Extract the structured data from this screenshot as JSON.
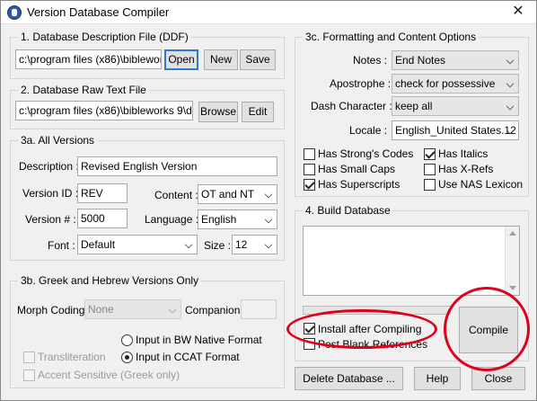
{
  "window": {
    "title": "Version Database Compiler"
  },
  "ddf": {
    "group_label": "1. Database Description File (DDF)",
    "path": "c:\\program files (x86)\\bibleworks 9",
    "open_label": "Open",
    "new_label": "New",
    "save_label": "Save"
  },
  "raw": {
    "group_label": "2. Database Raw Text File",
    "path": "c:\\program files (x86)\\bibleworks 9\\databa",
    "browse_label": "Browse",
    "edit_label": "Edit"
  },
  "all_versions": {
    "group_label": "3a.  All Versions",
    "description_label": "Description :",
    "description_value": "Revised English Version",
    "version_id_label": "Version ID :",
    "version_id_value": "REV",
    "content_label": "Content :",
    "content_value": "OT and NT",
    "version_num_label": "Version # :",
    "version_num_value": "5000",
    "language_label": "Language :",
    "language_value": "English",
    "font_label": "Font :",
    "font_value": "Default",
    "size_label": "Size :",
    "size_value": "12"
  },
  "greek_hebrew": {
    "group_label": "3b.  Greek and Hebrew Versions Only",
    "morph_label": "Morph Coding :",
    "morph_value": "None",
    "companion_label": "Companion :",
    "companion_value": "",
    "radio_bw_label": "Input in BW Native Format",
    "radio_ccat_label": "Input in CCAT Format",
    "transliteration_label": "Transliteration",
    "accent_label": "Accent Sensitive (Greek only)"
  },
  "formatting": {
    "group_label": "3c. Formatting and Content Options",
    "notes_label": "Notes :",
    "notes_value": "End Notes",
    "apostrophe_label": "Apostrophe :",
    "apostrophe_value": "check for possessive",
    "dash_label": "Dash Character :",
    "dash_value": "keep all",
    "locale_label": "Locale :",
    "locale_value": "English_United States.12",
    "has_strongs": "Has Strong's Codes",
    "has_small_caps": "Has Small Caps",
    "has_superscripts": "Has Superscripts",
    "has_italics": "Has Italics",
    "has_xrefs": "Has X-Refs",
    "use_nas": "Use NAS Lexicon"
  },
  "build": {
    "group_label": "4.  Build Database",
    "install_label": "Install after Compiling",
    "post_blank_label": "Post Blank References",
    "compile_label": "Compile"
  },
  "footer": {
    "delete_label": "Delete Database ...",
    "help_label": "Help",
    "close_label": "Close"
  },
  "colors": {
    "annotation": "#e0001b",
    "focus": "#2a7ad6"
  }
}
